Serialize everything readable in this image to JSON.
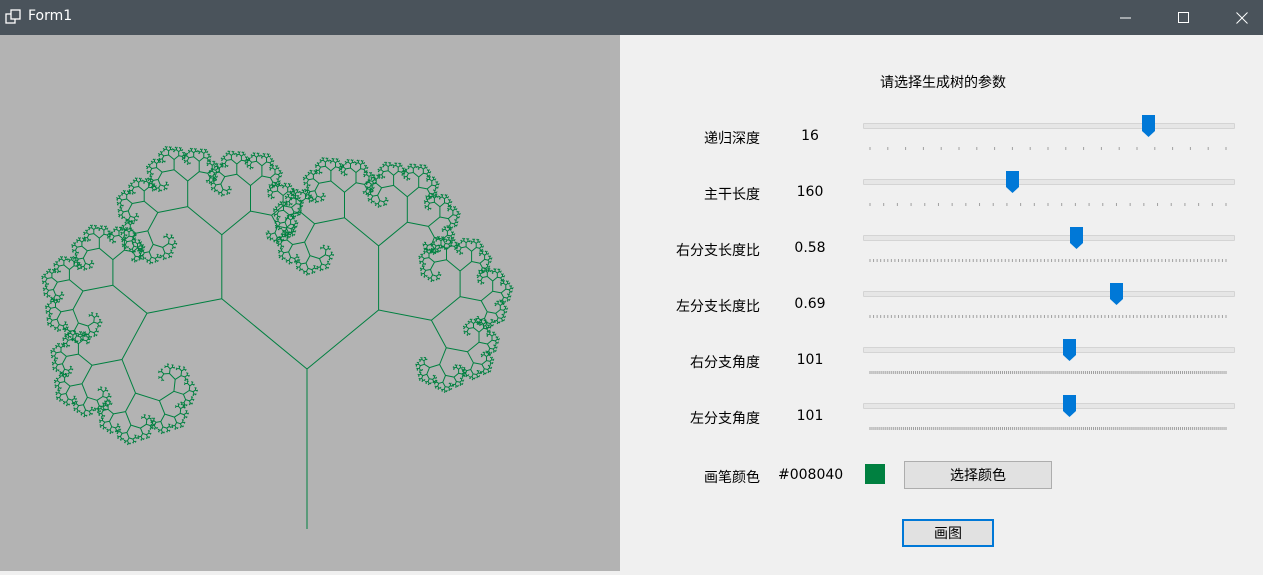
{
  "window": {
    "title": "Form1"
  },
  "panel": {
    "heading": "请选择生成树的参数",
    "params": [
      {
        "label": "递归深度",
        "value": "16",
        "level": 0.78,
        "tick_count": 21
      },
      {
        "label": "主干长度",
        "value": "160",
        "level": 0.4,
        "tick_count": 27
      },
      {
        "label": "右分支长度比",
        "value": "0.58",
        "level": 0.58,
        "tick_count": 101
      },
      {
        "label": "左分支长度比",
        "value": "0.69",
        "level": 0.69,
        "tick_count": 101
      },
      {
        "label": "右分支角度",
        "value": "101",
        "level": 0.56,
        "tick_count": 181
      },
      {
        "label": "左分支角度",
        "value": "101",
        "level": 0.56,
        "tick_count": 181
      }
    ],
    "pen": {
      "label": "画笔颜色",
      "value": "#008040",
      "color": "#008040"
    },
    "choose_color_label": "选择颜色",
    "draw_label": "画图"
  },
  "colors": {
    "accent": "#0078d7",
    "canvas_bg": "#b3b3b3",
    "tree": "#008040"
  },
  "icons": {
    "app": "window-icon",
    "minimize": "minimize-icon",
    "maximize": "maximize-icon",
    "close": "close-icon"
  }
}
